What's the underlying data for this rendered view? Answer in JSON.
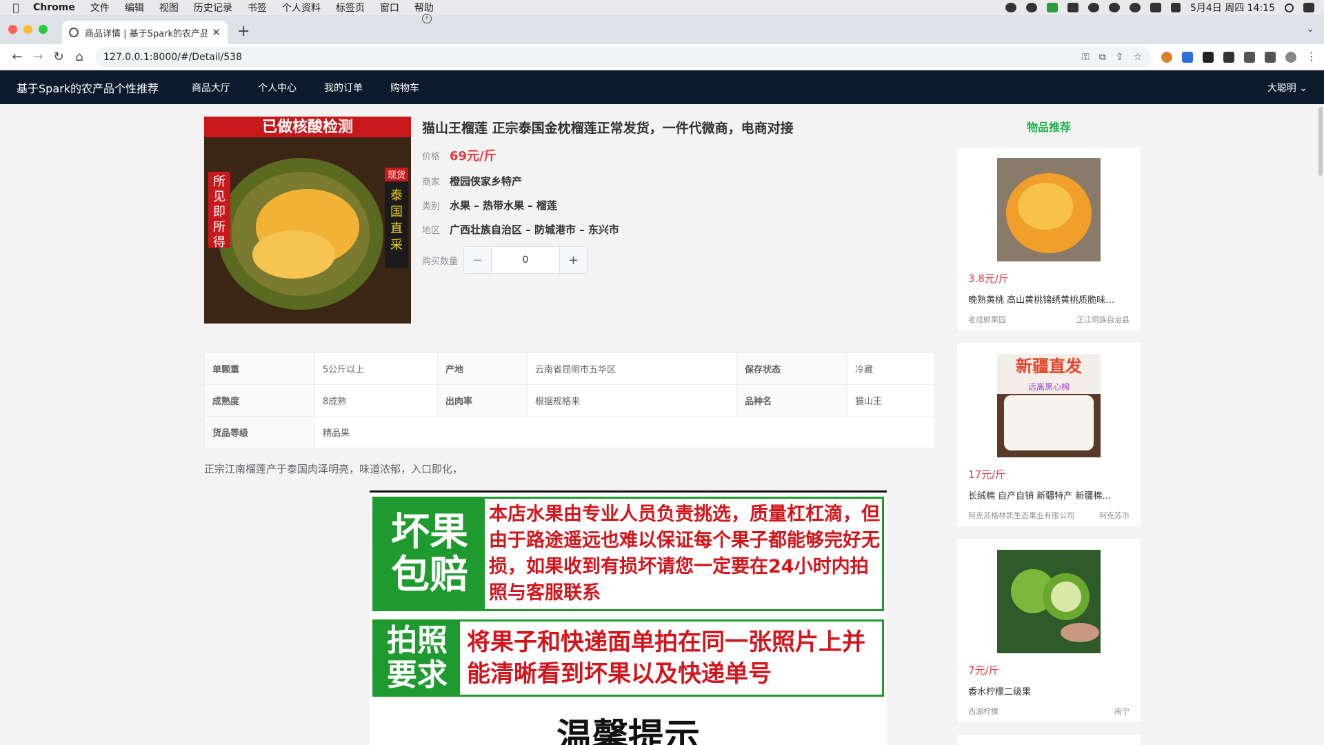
{
  "menubar": {
    "app": "Chrome",
    "items": [
      "文件",
      "编辑",
      "视图",
      "历史记录",
      "书签",
      "个人资料",
      "标签页",
      "窗口",
      "帮助"
    ],
    "clock": "5月4日 周四 14:15"
  },
  "browser": {
    "tab_title": "商品详情 | 基于Spark的农产品个",
    "url": "127.0.0.1:8000/#/Detail/538"
  },
  "appnav": {
    "brand": "基于Spark的农产品个性推荐",
    "items": [
      "商品大厅",
      "个人中心",
      "我的订单",
      "购物车"
    ],
    "user": "大聪明"
  },
  "product": {
    "title": "猫山王榴莲 正宗泰国金枕榴莲正常发货，一件代微商，电商对接",
    "price_label": "价格",
    "price": "69元/斤",
    "merchant_label": "商家",
    "merchant": "橙园侠家乡特产",
    "category_label": "类别",
    "category": "水果 – 热带水果 – 榴莲",
    "region_label": "地区",
    "region": "广西壮族自治区 – 防城港市 – 东兴市",
    "qty_label": "购买数量",
    "qty": "0",
    "image_texts": {
      "top": "已做核酸检测",
      "left": "所见即所得",
      "right_tag": "现货",
      "right": "泰国直采"
    }
  },
  "specs": [
    [
      "单颗重",
      "5公斤以上",
      "产地",
      "云南省昆明市五华区",
      "保存状态",
      "冷藏"
    ],
    [
      "成熟度",
      "8成熟",
      "出肉率",
      "根据规格来",
      "品种名",
      "猫山王"
    ],
    [
      "货品等级",
      "精品果"
    ]
  ],
  "description": "正宗江南榴莲产于泰国肉泽明亮，味道浓郁，入口即化，",
  "banner": {
    "block1_left": "坏果包赔",
    "block1_right": "本店水果由专业人员负责挑选，质量杠杠滴，但由于路途遥远也难以保证每个果子都能够完好无损，如果收到有损坏请您一定要在24小时内拍照与客服联系",
    "block2_left": "拍照要求",
    "block2_right": "将果子和快递面单拍在同一张照片上并能清晰看到坏果以及快递单号",
    "block3": "温馨提示"
  },
  "recommend": {
    "title": "物品推荐",
    "items": [
      {
        "price": "3.8元/斤",
        "name": "晚熟黄桃 高山黄桃锦绣黄桃质脆味…",
        "merchant": "老成鲜果园",
        "place": "芷江侗族自治县",
        "img_text": ""
      },
      {
        "price": "17元/斤",
        "name": "长绒棉 自产自销 新疆特产 新疆棉…",
        "merchant": "阿克苏格林凯生态果业有限公司",
        "place": "阿克苏市",
        "img_text": "新疆直发",
        "img_sub": "远离黑心棉"
      },
      {
        "price": "7元/斤",
        "name": "香水柠檬二级果",
        "merchant": "西湖柠檬",
        "place": "南宁",
        "img_text": ""
      }
    ]
  },
  "colors": {
    "navbar": "#0c1a2b",
    "price": "#e6393d",
    "accent_green": "#21b04b"
  }
}
